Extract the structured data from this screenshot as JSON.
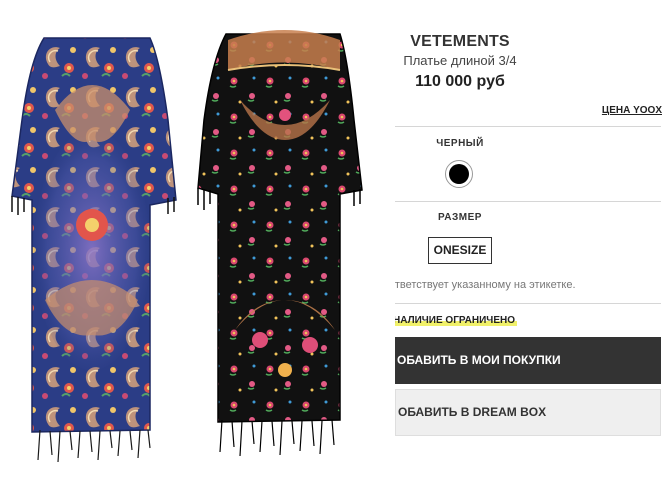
{
  "product": {
    "brand": "VETEMENTS",
    "name": "Платье длиной 3/4",
    "price": "110 000 руб",
    "price_link": "ЦЕНА YOOX"
  },
  "color": {
    "label": "ЧЕРНЫЙ",
    "selected_hex": "#000000"
  },
  "size": {
    "label": "РАЗМЕР",
    "value": "ONESIZE",
    "note": "ответствует указанному на этикетке."
  },
  "availability": {
    "badge": "НАЛИЧИЕ ОГРАНИЧЕНО",
    "highlight_color": "#f1f16a"
  },
  "actions": {
    "buy_label": "ОБАВИТЬ В МОИ ПОКУПКИ",
    "dreambox_label": "ОБАВИТЬ В DREAM BOX"
  },
  "gallery": {
    "images": [
      "dress-blue-paisley",
      "dress-black-floral"
    ]
  },
  "colors": {
    "dark_button": "#333333",
    "light_button": "#efefef",
    "divider": "#d6d6d6"
  }
}
